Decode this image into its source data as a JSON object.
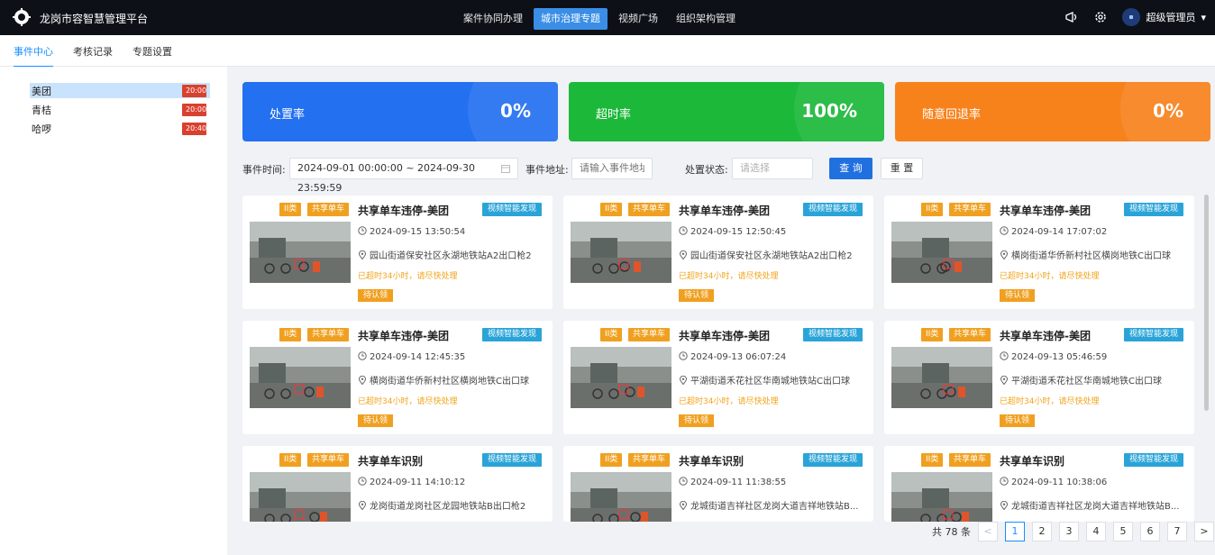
{
  "app": {
    "title": "龙岗市容智慧管理平台"
  },
  "topnav": [
    {
      "label": "案件协同办理"
    },
    {
      "label": "城市治理专题"
    },
    {
      "label": "视频广场"
    },
    {
      "label": "组织架构管理"
    }
  ],
  "user": {
    "name": "超级管理员"
  },
  "subnav": [
    {
      "label": "事件中心"
    },
    {
      "label": "考核记录"
    },
    {
      "label": "专题设置"
    }
  ],
  "sidebar": {
    "items": [
      {
        "label": "美团",
        "badge": "20:00"
      },
      {
        "label": "青桔",
        "badge": "20:00"
      },
      {
        "label": "哈啰",
        "badge": "20:40"
      }
    ]
  },
  "stats": [
    {
      "label": "处置率",
      "value": "0%",
      "color": "#2370f0"
    },
    {
      "label": "超时率",
      "value": "100%",
      "color": "#1cb83a"
    },
    {
      "label": "随意回退率",
      "value": "0%",
      "color": "#f7821c"
    }
  ],
  "filter": {
    "time_label": "事件时间:",
    "time_range": "2024-09-01 00:00:00   ~  2024-09-30 23:59:59",
    "address_label": "事件地址:",
    "address_placeholder": "请输入事件地址",
    "status_label": "处置状态:",
    "status_placeholder": "请选择",
    "search_label": "查 询",
    "reset_label": "重 置"
  },
  "events": [
    {
      "class": "II类",
      "category": "共享单车",
      "title": "共享单车违停-美团",
      "source": "视频智能发现",
      "time": "2024-09-15 13:50:54",
      "address": "园山街道保安社区永湖地铁站A2出口枪2",
      "warning": "已超时34小时，请尽快处理",
      "status": "待认领"
    },
    {
      "class": "II类",
      "category": "共享单车",
      "title": "共享单车违停-美团",
      "source": "视频智能发现",
      "time": "2024-09-15 12:50:45",
      "address": "园山街道保安社区永湖地铁站A2出口枪2",
      "warning": "已超时34小时，请尽快处理",
      "status": "待认领"
    },
    {
      "class": "II类",
      "category": "共享单车",
      "title": "共享单车违停-美团",
      "source": "视频智能发现",
      "time": "2024-09-14 17:07:02",
      "address": "横岗街道华侨新村社区横岗地铁C出口球",
      "warning": "已超时34小时，请尽快处理",
      "status": "待认领"
    },
    {
      "class": "II类",
      "category": "共享单车",
      "title": "共享单车违停-美团",
      "source": "视频智能发现",
      "time": "2024-09-14 12:45:35",
      "address": "横岗街道华侨新村社区横岗地铁C出口球",
      "warning": "已超时34小时，请尽快处理",
      "status": "待认领"
    },
    {
      "class": "II类",
      "category": "共享单车",
      "title": "共享单车违停-美团",
      "source": "视频智能发现",
      "time": "2024-09-13 06:07:24",
      "address": "平湖街道禾花社区华南城地铁站C出口球",
      "warning": "已超时34小时，请尽快处理",
      "status": "待认领"
    },
    {
      "class": "II类",
      "category": "共享单车",
      "title": "共享单车违停-美团",
      "source": "视频智能发现",
      "time": "2024-09-13 05:46:59",
      "address": "平湖街道禾花社区华南城地铁C出口球",
      "warning": "已超时34小时，请尽快处理",
      "status": "待认领"
    },
    {
      "class": "II类",
      "category": "共享单车",
      "title": "共享单车识别",
      "source": "视频智能发现",
      "time": "2024-09-11 14:10:12",
      "address": "龙岗街道龙岗社区龙园地铁站B出口枪2",
      "warning": "",
      "status": ""
    },
    {
      "class": "II类",
      "category": "共享单车",
      "title": "共享单车识别",
      "source": "视频智能发现",
      "time": "2024-09-11 11:38:55",
      "address": "龙城街道吉祥社区龙岗大道吉祥地铁站B...",
      "warning": "",
      "status": ""
    },
    {
      "class": "II类",
      "category": "共享单车",
      "title": "共享单车识别",
      "source": "视频智能发现",
      "time": "2024-09-11 10:38:06",
      "address": "龙城街道吉祥社区龙岗大道吉祥地铁站B...",
      "warning": "",
      "status": ""
    }
  ],
  "pagination": {
    "total": "共 78 条",
    "prev": "<",
    "next": ">",
    "pages": [
      "1",
      "2",
      "3",
      "4",
      "5",
      "6",
      "7"
    ],
    "current": "1"
  }
}
